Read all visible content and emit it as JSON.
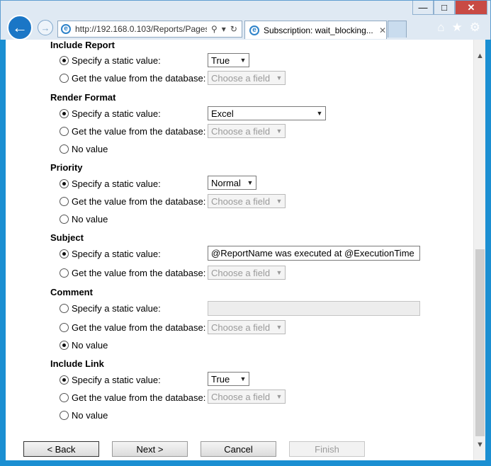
{
  "browser": {
    "address": "http://192.168.0.103/Reports/Pages",
    "tab_title": "Subscription: wait_blocking...",
    "window_buttons": {
      "minimize": "—",
      "maximize": "□",
      "close": "✕"
    },
    "icons": {
      "back": "←",
      "forward": "→",
      "search": "⚲",
      "dropdown": "▾",
      "refresh": "↻",
      "tab_close": "✕",
      "home": "⌂",
      "favorites": "★",
      "tools": "⚙"
    }
  },
  "form": {
    "common": {
      "static_label": "Specify a static value:",
      "db_label": "Get the value from the database:",
      "none_label": "No value",
      "choose_field": "Choose a field"
    },
    "include_report": {
      "title": "Include Report",
      "static_value": "True",
      "selected": "static"
    },
    "render_format": {
      "title": "Render Format",
      "static_value": "Excel",
      "selected": "static"
    },
    "priority": {
      "title": "Priority",
      "static_value": "Normal",
      "selected": "static"
    },
    "subject": {
      "title": "Subject",
      "static_value": "@ReportName was executed at @ExecutionTime",
      "selected": "static"
    },
    "comment": {
      "title": "Comment",
      "static_value": "",
      "selected": "none"
    },
    "include_link": {
      "title": "Include Link",
      "static_value": "True",
      "selected": "static"
    }
  },
  "buttons": {
    "back": "< Back",
    "next": "Next >",
    "cancel": "Cancel",
    "finish": "Finish"
  }
}
